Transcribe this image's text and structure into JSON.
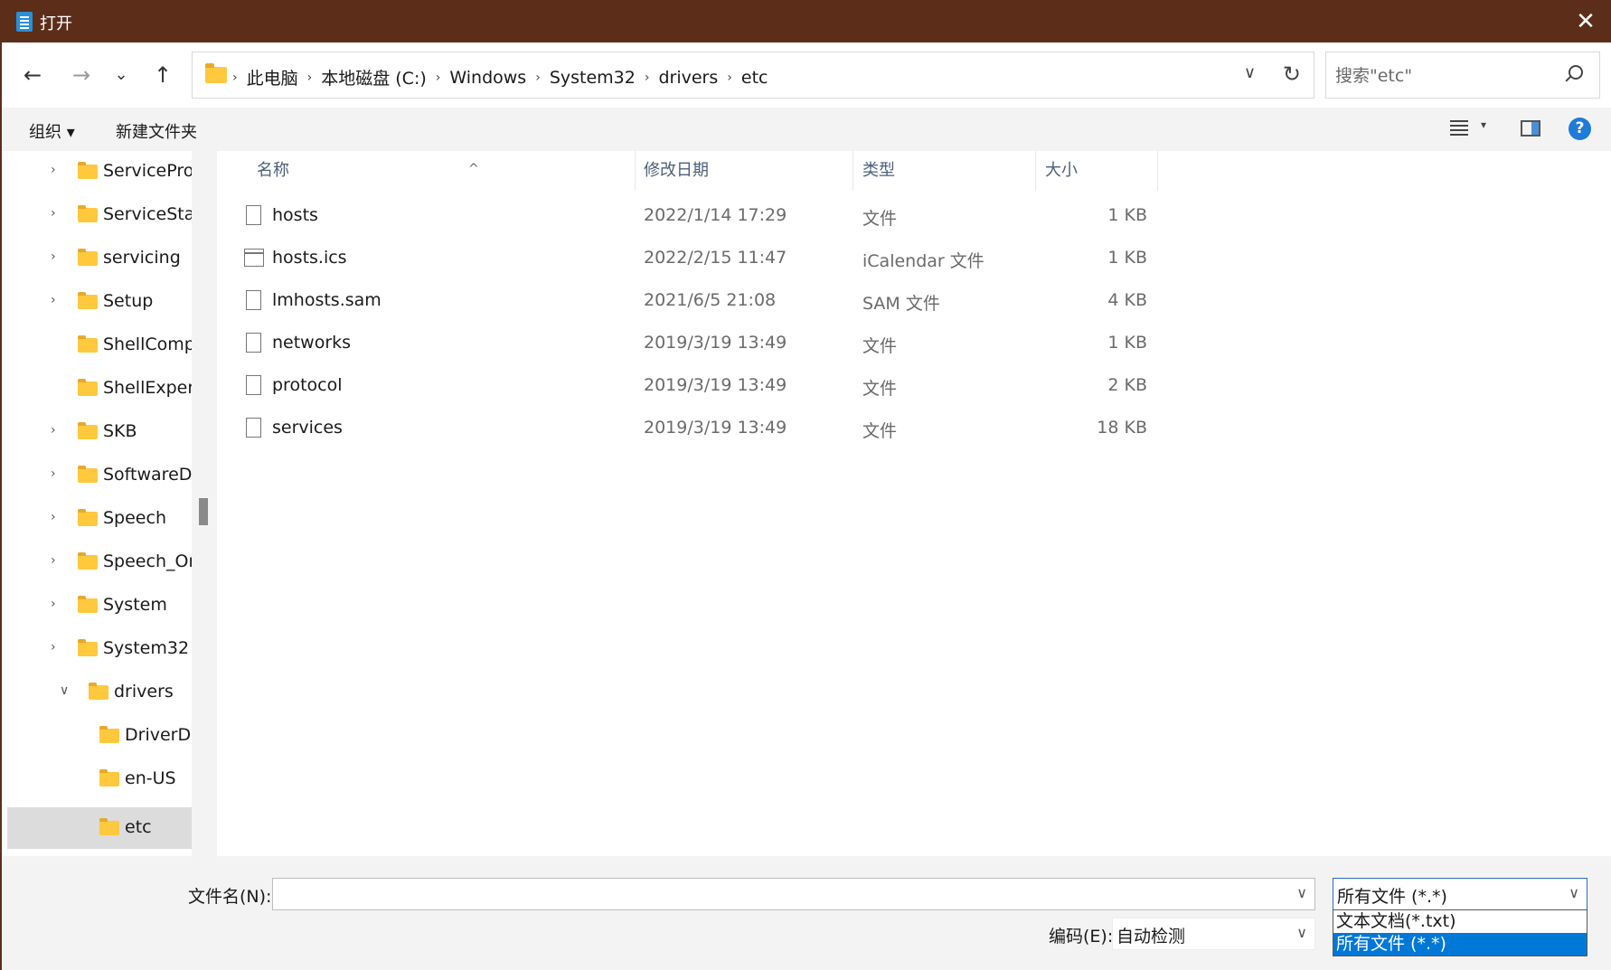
{
  "titlebar": {
    "title": "打开",
    "close": "✕"
  },
  "nav": {
    "back": "←",
    "forward": "→",
    "recent": "⌄",
    "up": "↑"
  },
  "address": {
    "crumbs": [
      "此电脑",
      "本地磁盘 (C:)",
      "Windows",
      "System32",
      "drivers",
      "etc"
    ],
    "separator": "›",
    "dropdown": "∨",
    "refresh": "↻"
  },
  "search": {
    "placeholder": "搜索\"etc\""
  },
  "commands": {
    "organize": "组织 ▾",
    "new_folder": "新建文件夹",
    "view_caret": "▾",
    "help": "?"
  },
  "tree": {
    "items": [
      {
        "label": "ServiceProfi",
        "chevron": "›"
      },
      {
        "label": "ServiceState",
        "chevron": "›"
      },
      {
        "label": "servicing",
        "chevron": "›"
      },
      {
        "label": "Setup",
        "chevron": "›"
      },
      {
        "label": "ShellCompo",
        "chevron": ""
      },
      {
        "label": "ShellExperie",
        "chevron": ""
      },
      {
        "label": "SKB",
        "chevron": "›"
      },
      {
        "label": "SoftwareDis",
        "chevron": "›"
      },
      {
        "label": "Speech",
        "chevron": "›"
      },
      {
        "label": "Speech_One",
        "chevron": "›"
      },
      {
        "label": "System",
        "chevron": "›"
      },
      {
        "label": "System32",
        "chevron": "›"
      },
      {
        "label": "drivers",
        "chevron": "∨"
      },
      {
        "label": "DriverDa",
        "chevron": ""
      },
      {
        "label": "en-US",
        "chevron": ""
      },
      {
        "label": "etc",
        "chevron": ""
      }
    ]
  },
  "list": {
    "columns": {
      "name": "名称",
      "date": "修改日期",
      "type": "类型",
      "size": "大小",
      "sort": "^"
    },
    "rows": [
      {
        "name": "hosts",
        "date": "2022/1/14 17:29",
        "type": "文件",
        "size": "1 KB"
      },
      {
        "name": "hosts.ics",
        "date": "2022/2/15 11:47",
        "type": "iCalendar 文件",
        "size": "1 KB"
      },
      {
        "name": "lmhosts.sam",
        "date": "2021/6/5 21:08",
        "type": "SAM 文件",
        "size": "4 KB"
      },
      {
        "name": "networks",
        "date": "2019/3/19 13:49",
        "type": "文件",
        "size": "1 KB"
      },
      {
        "name": "protocol",
        "date": "2019/3/19 13:49",
        "type": "文件",
        "size": "2 KB"
      },
      {
        "name": "services",
        "date": "2019/3/19 13:49",
        "type": "文件",
        "size": "18 KB"
      }
    ]
  },
  "footer": {
    "filename_label": "文件名(N):",
    "filename_value": "",
    "filetype_value": "所有文件 (*.*)",
    "filetype_options": [
      "文本文档(*.txt)",
      "所有文件 (*.*)"
    ],
    "encoding_label": "编码(E):",
    "encoding_value": "自动检测",
    "caret": "∨"
  },
  "colors": {
    "titlebar": "#5c2e1a",
    "accent": "#0078d7",
    "folder": "#ffc83d"
  }
}
